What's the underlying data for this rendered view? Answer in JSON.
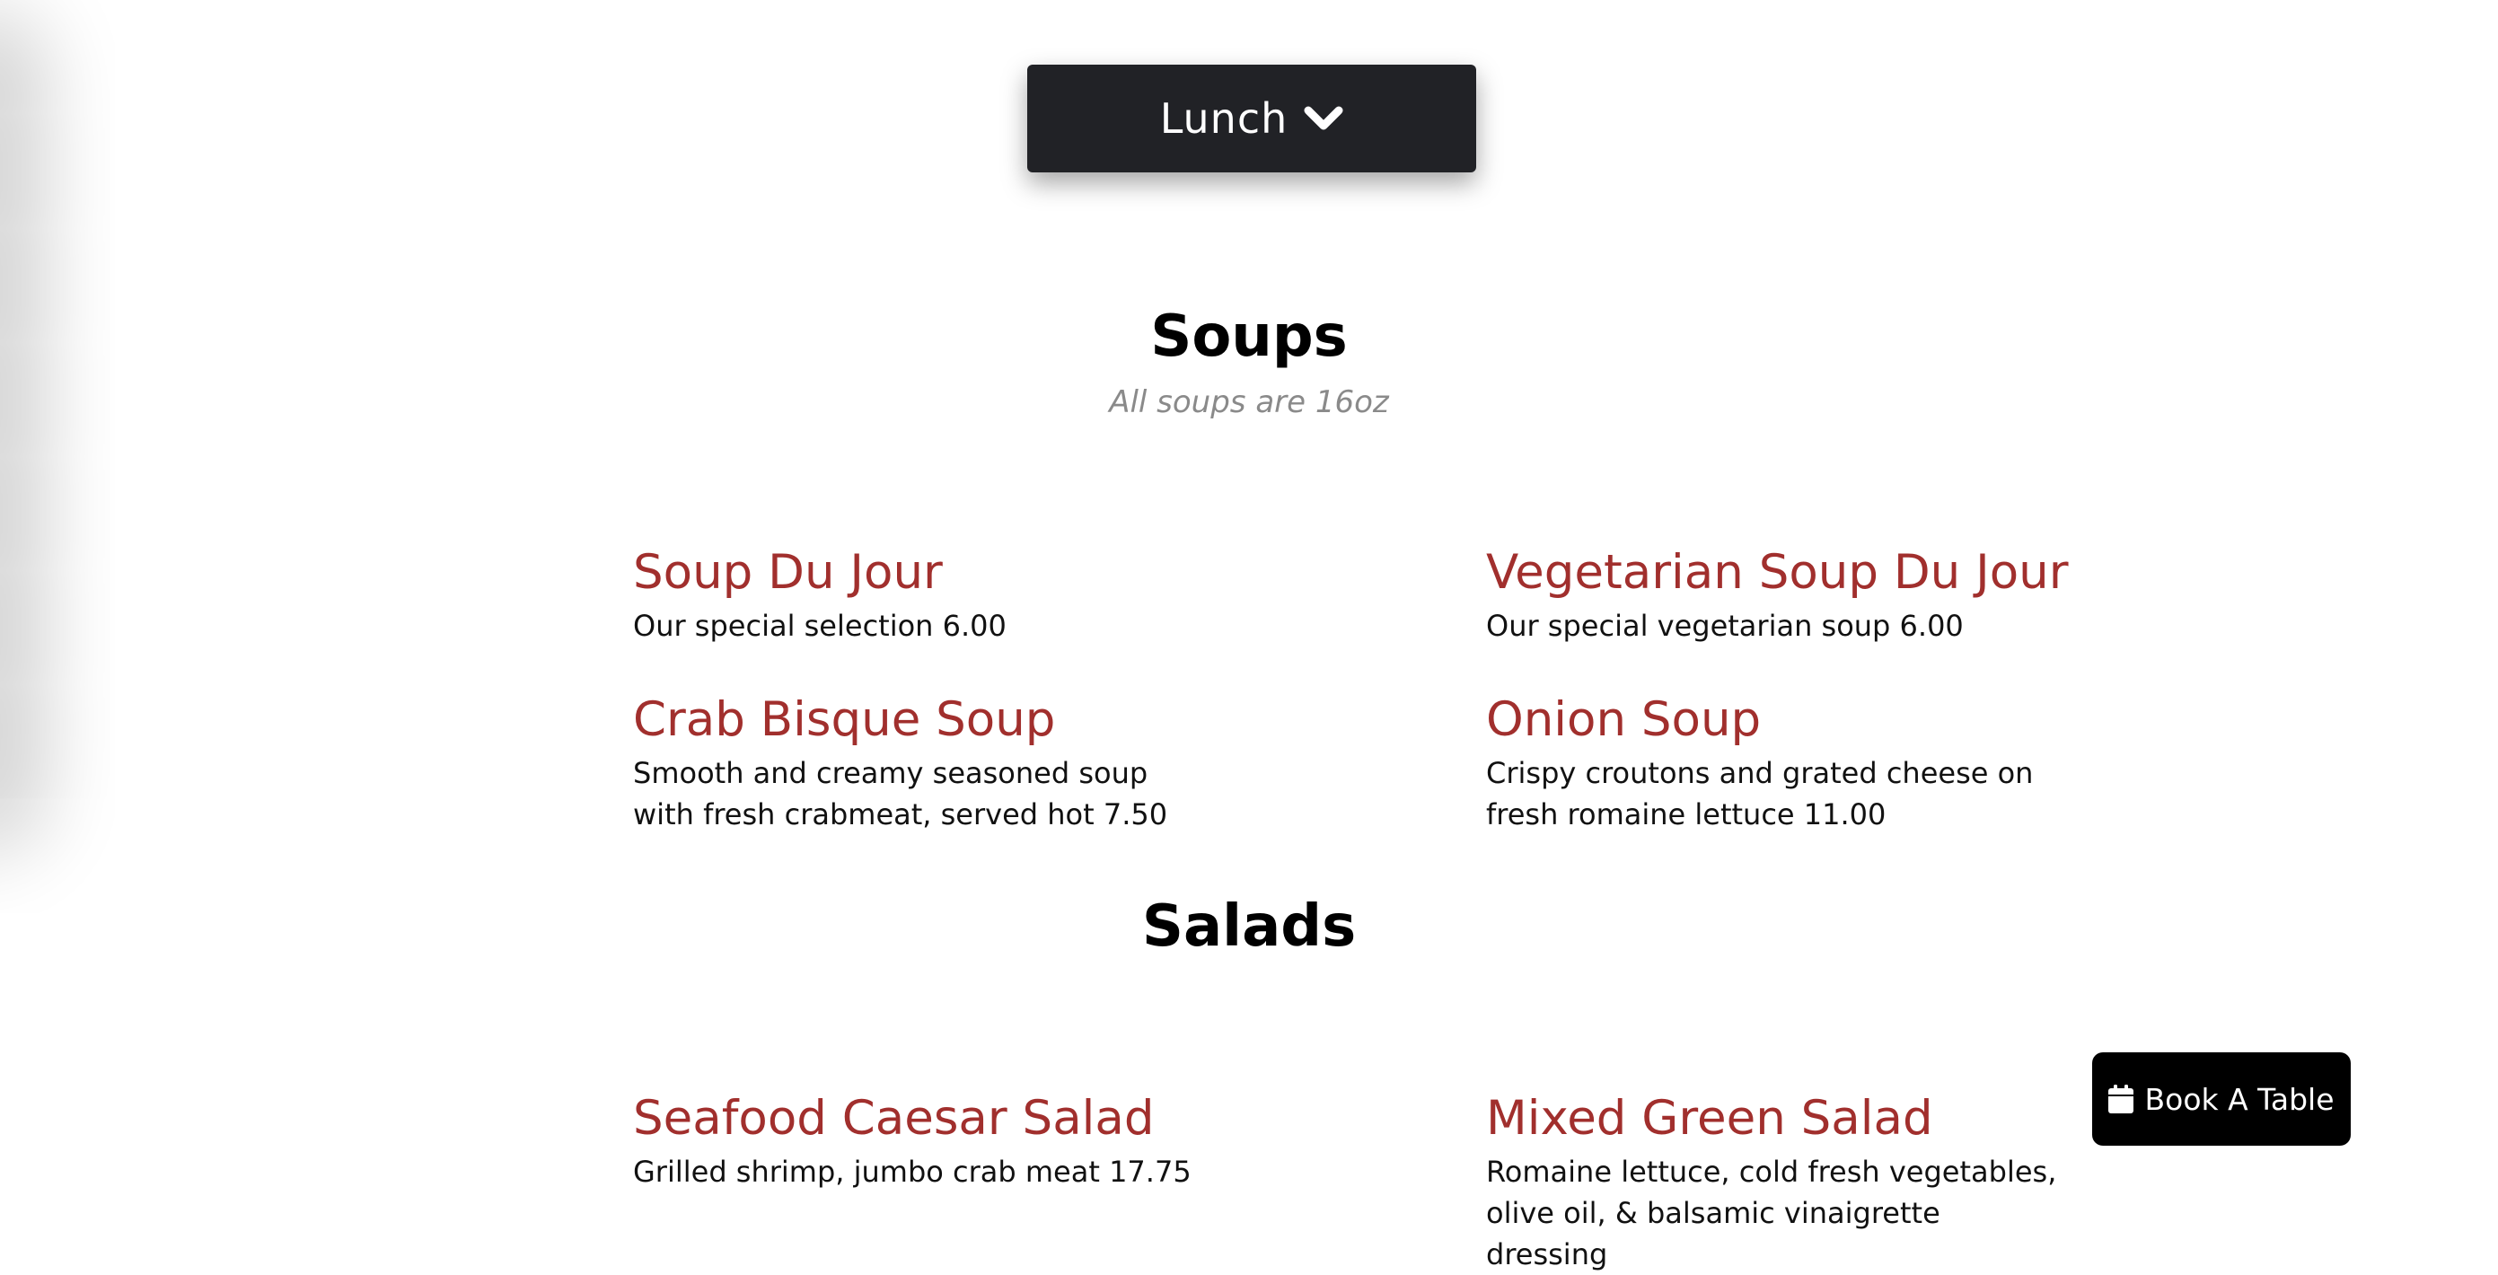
{
  "menu_selector": {
    "label": "Lunch",
    "icon": "chevron-down-icon"
  },
  "sections": [
    {
      "title": "Soups",
      "subtitle": "All soups are 16oz",
      "items": [
        {
          "name": "Soup Du Jour",
          "description": "Our special selection 6.00"
        },
        {
          "name": "Vegetarian Soup Du Jour",
          "description": "Our special vegetarian soup 6.00"
        },
        {
          "name": "Crab Bisque Soup",
          "description": "Smooth and creamy seasoned soup with fresh crabmeat, served hot 7.50"
        },
        {
          "name": "Onion Soup",
          "description": "Crispy croutons and grated cheese on fresh romaine lettuce 11.00"
        }
      ]
    },
    {
      "title": "Salads",
      "items": [
        {
          "name": "Seafood Caesar Salad",
          "description": "Grilled shrimp, jumbo crab meat 17.75"
        },
        {
          "name": "Mixed Green Salad",
          "description": "Romaine lettuce, cold fresh vegetables, olive oil, & balsamic vinaigrette dressing"
        }
      ]
    }
  ],
  "book_button": {
    "label": "Book A Table",
    "icon": "calendar-icon"
  },
  "colors": {
    "item_name": "#a12f2d",
    "dropdown_bg": "#212226",
    "subtitle": "#8a8a8a"
  }
}
